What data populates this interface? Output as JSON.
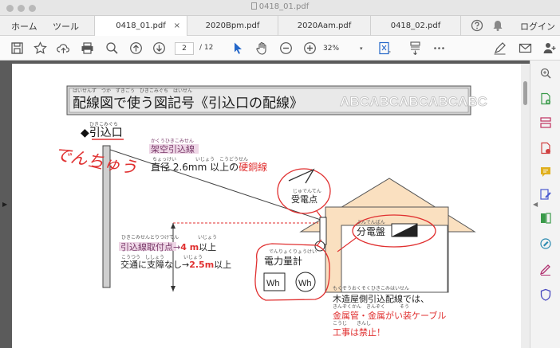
{
  "window": {
    "title": "0418_01.pdf"
  },
  "menu": {
    "home": "ホーム",
    "tools": "ツール",
    "login": "ログイン"
  },
  "tabs": [
    {
      "label": "0418_01.pdf",
      "close": "×"
    },
    {
      "label": "2020Bpm.pdf"
    },
    {
      "label": "2020Aam.pdf"
    },
    {
      "label": "0418_02.pdf"
    }
  ],
  "toolbar": {
    "page_current": "2",
    "page_total": "/ 12",
    "zoom": "32%"
  },
  "document": {
    "title": "配線図で使う図記号《引込口の配線》",
    "title_ruby": "はいせんず　つか　ずきごう　ひきこみぐち　はいせん",
    "deco": [
      "ABC",
      "ABC",
      "ABC",
      "ABC",
      "ABC"
    ],
    "entry_label": "◆引込口",
    "entry_ruby": "ひきこみぐち",
    "overhead_label": "架空引込線",
    "overhead_ruby": "かくうひきこみせん",
    "wire_spec": "直径 2.6mm 以上の",
    "wire_ruby": "ちょっけい　　　　いじょう　こうどうせん",
    "wire_spec_red": "硬銅線",
    "receive_label": "受電点",
    "receive_ruby": "じゅでんてん",
    "panel_label": "分電盤",
    "panel_ruby": "ぶんでんばん",
    "attach_label": "引込線取付点→",
    "attach_value": "4 m",
    "attach_suffix": "以上",
    "attach_ruby": "ひきこみせんとりつけてん　　　　いじょう",
    "traffic_label": "交通に支障なし→",
    "traffic_value": "2.5m",
    "traffic_suffix": "以上",
    "traffic_ruby": "こうつう　ししょう　　　　いじょう",
    "meter_label": "電力量計",
    "meter_ruby": "でんりょくりょうけい",
    "meter_symbol": "Wh",
    "wooden_note": "木造屋側引込配線では、",
    "wooden_ruby": "もくぞうおくそくひきこみはいせん",
    "metal_note": "金属管・金属がい装ケーブル",
    "metal_ruby": "きんぞくかん　きんぞく　　　そう",
    "prohibited_note": "工事は禁止！",
    "prohibited_ruby": "こうじ　　きんし",
    "handwriting": "でんちゅう"
  },
  "colors": {
    "red": "#e03030",
    "wall": "#fae0c0",
    "purple": "#7a3a6a"
  }
}
